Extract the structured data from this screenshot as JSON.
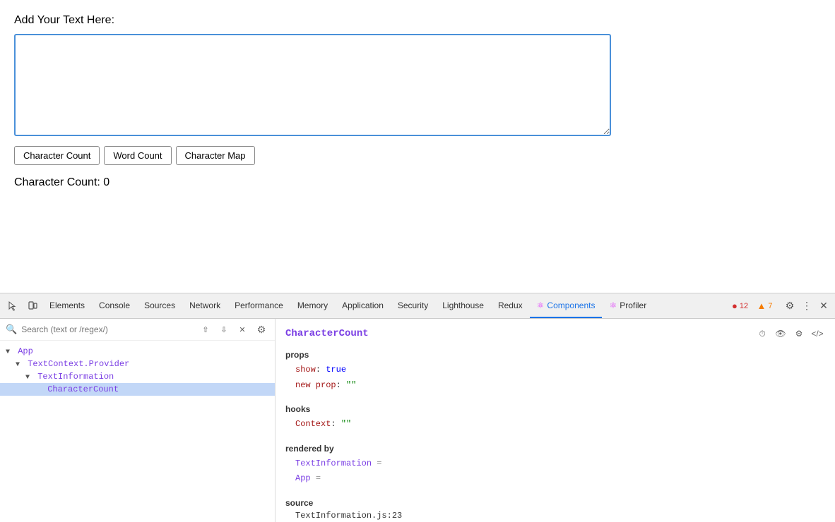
{
  "app": {
    "label": "Add Your Text Here:",
    "textarea": {
      "placeholder": "",
      "value": ""
    },
    "buttons": [
      {
        "id": "char-count-btn",
        "label": "Character Count"
      },
      {
        "id": "word-count-btn",
        "label": "Word Count"
      },
      {
        "id": "char-map-btn",
        "label": "Character Map"
      }
    ],
    "result_label": "Character Count: 0"
  },
  "devtools": {
    "tabs": [
      {
        "id": "elements",
        "label": "Elements",
        "active": false
      },
      {
        "id": "console",
        "label": "Console",
        "active": false
      },
      {
        "id": "sources",
        "label": "Sources",
        "active": false
      },
      {
        "id": "network",
        "label": "Network",
        "active": false
      },
      {
        "id": "performance",
        "label": "Performance",
        "active": false
      },
      {
        "id": "memory",
        "label": "Memory",
        "active": false
      },
      {
        "id": "application",
        "label": "Application",
        "active": false
      },
      {
        "id": "security",
        "label": "Security",
        "active": false
      },
      {
        "id": "lighthouse",
        "label": "Lighthouse",
        "active": false
      },
      {
        "id": "redux",
        "label": "Redux",
        "active": false
      },
      {
        "id": "components",
        "label": "Components",
        "active": true
      },
      {
        "id": "profiler",
        "label": "Profiler",
        "active": false
      }
    ],
    "error_count": "12",
    "warn_count": "7",
    "search_placeholder": "Search (text or /regex/)",
    "component_tree": [
      {
        "id": "app",
        "label": "▾ App",
        "indent": 0,
        "selected": false
      },
      {
        "id": "textcontext-provider",
        "label": "▾ TextContext.Provider",
        "indent": 1,
        "selected": false
      },
      {
        "id": "textinformation",
        "label": "▾ TextInformation",
        "indent": 2,
        "selected": false
      },
      {
        "id": "charactercount",
        "label": "CharacterCount",
        "indent": 3,
        "selected": true
      }
    ],
    "right_panel": {
      "component_name": "CharacterCount",
      "props": {
        "title": "props",
        "items": [
          {
            "key": "show",
            "colon": ":",
            "value": "true",
            "type": "bool"
          },
          {
            "key": "new prop",
            "colon": ":",
            "value": "\"\"",
            "type": "str"
          }
        ]
      },
      "hooks": {
        "title": "hooks",
        "items": [
          {
            "key": "Context",
            "colon": ":",
            "value": "\"\"",
            "type": "str"
          }
        ]
      },
      "rendered_by": {
        "title": "rendered by",
        "items": [
          {
            "label": "TextInformation",
            "arrow": "="
          },
          {
            "label": "App",
            "arrow": "="
          }
        ]
      },
      "source": {
        "title": "source",
        "value": "TextInformation.js:23"
      }
    }
  }
}
